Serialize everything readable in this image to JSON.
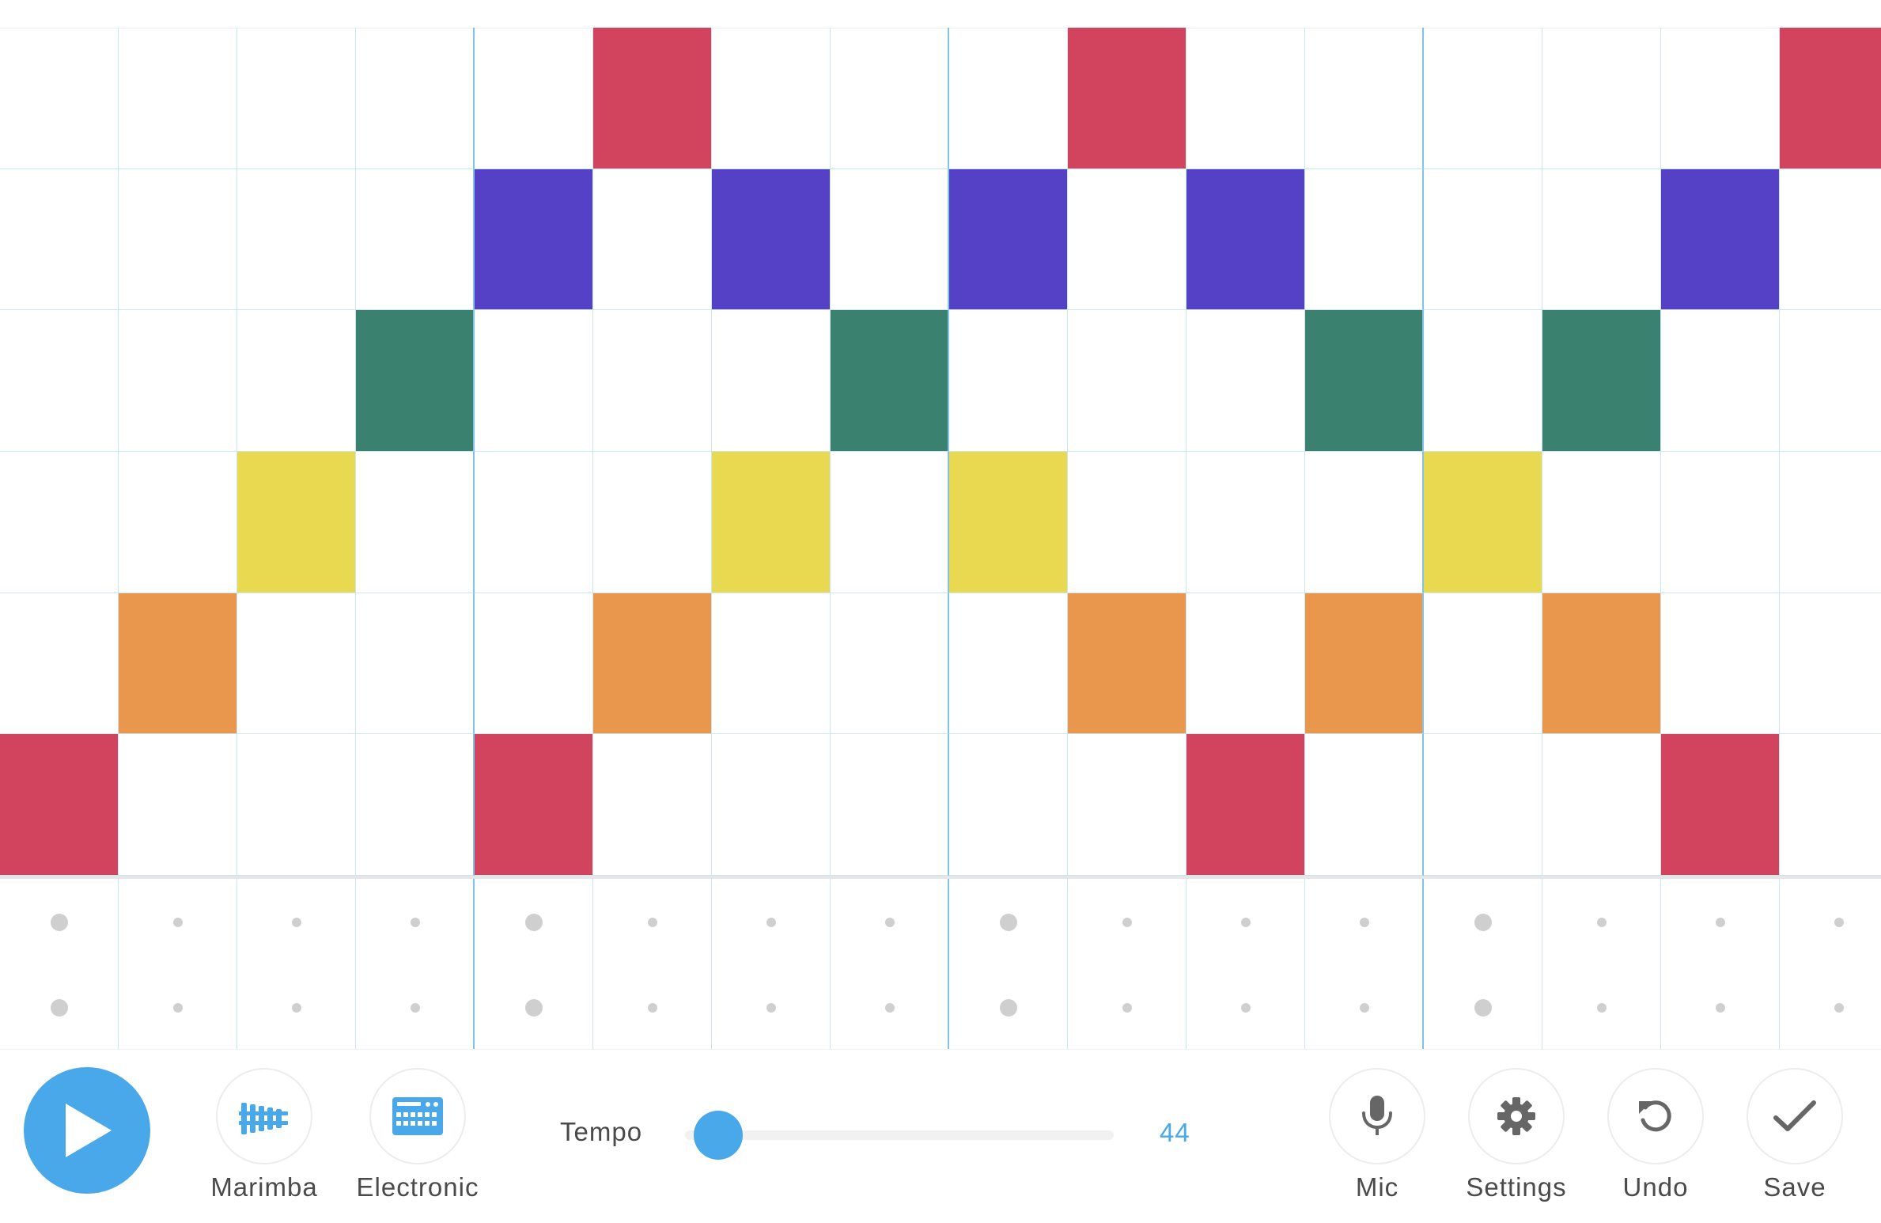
{
  "grid": {
    "columns": 16,
    "melody_rows": 6,
    "bar_every": 4,
    "row_colors": [
      "#d2435e",
      "#5441c6",
      "#3b8170",
      "#e8d950",
      "#e9974d",
      "#d2435e"
    ],
    "notes": [
      [
        5
      ],
      [
        4
      ],
      [
        3
      ],
      [
        2
      ],
      [
        1,
        5
      ],
      [
        0,
        4
      ],
      [
        1,
        3
      ],
      [
        2
      ],
      [
        1,
        3
      ],
      [
        0,
        4
      ],
      [
        1,
        5
      ],
      [
        2,
        4
      ],
      [
        3
      ],
      [
        2,
        4
      ],
      [
        1,
        5
      ],
      [
        0
      ]
    ],
    "rhythm_rows": 2,
    "accent_every": 4,
    "line_color": "#c9e6f5",
    "bar_line_color": "#7fc3e6"
  },
  "toolbar": {
    "play_icon": "play-icon",
    "accent_color": "#48a8ea",
    "instruments": [
      {
        "label": "Marimba",
        "icon": "marimba-icon"
      },
      {
        "label": "Electronic",
        "icon": "electronic-keyboard-icon"
      }
    ],
    "tempo": {
      "label": "Tempo",
      "value": "44",
      "fraction": 0.04
    },
    "actions": [
      {
        "label": "Mic",
        "icon": "mic-icon"
      },
      {
        "label": "Settings",
        "icon": "gear-icon"
      },
      {
        "label": "Undo",
        "icon": "undo-icon"
      },
      {
        "label": "Save",
        "icon": "checkmark-icon"
      }
    ]
  }
}
